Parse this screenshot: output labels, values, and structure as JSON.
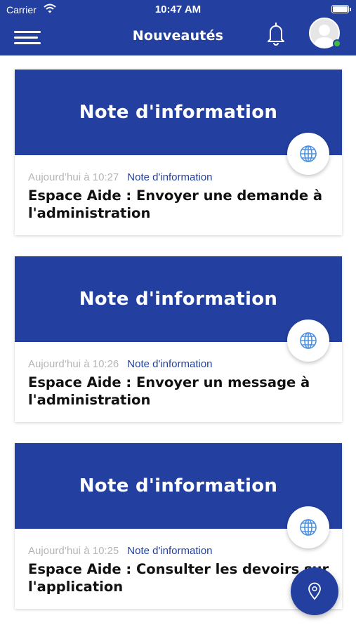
{
  "status_bar": {
    "carrier": "Carrier",
    "time": "10:47 AM"
  },
  "nav": {
    "title": "Nouveautés"
  },
  "colors": {
    "primary": "#2340a0",
    "date_text": "#b5b5b5",
    "online": "#3cbe3c"
  },
  "icons": {
    "menu": "hamburger-icon",
    "notifications": "bell-icon",
    "profile": "avatar",
    "card_badge": "globe-icon",
    "fab": "location-pin-icon"
  },
  "cards": [
    {
      "banner": "Note d'information",
      "date": "Aujourd’hui à 10:27",
      "category": "Note d'information",
      "title": "Espace Aide : Envoyer une demande à l'administration"
    },
    {
      "banner": "Note d'information",
      "date": "Aujourd’hui à 10:26",
      "category": "Note d'information",
      "title": "Espace Aide : Envoyer un message à l'administration"
    },
    {
      "banner": "Note d'information",
      "date": "Aujourd’hui à 10:25",
      "category": "Note d'information",
      "title": "Espace Aide : Consulter les devoirs sur l'application"
    }
  ]
}
